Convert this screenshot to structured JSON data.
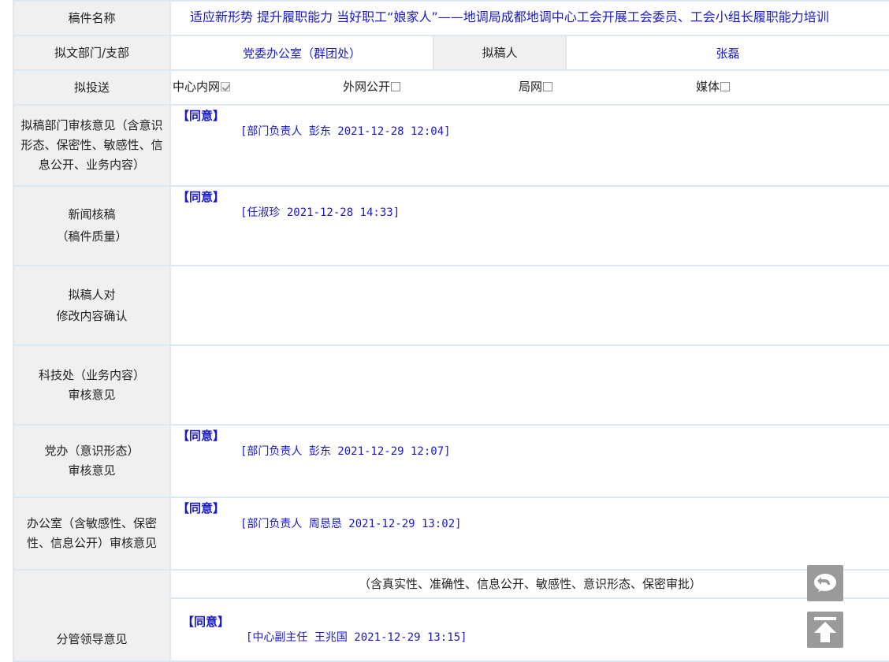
{
  "rows": {
    "title": {
      "label": "稿件名称",
      "value": "适应新形势 提升履职能力 当好职工“娘家人”——地调局成都地调中心工会开展工会委员、工会小组长履职能力培训"
    },
    "dept": {
      "label": "拟文部门/支部",
      "value": "党委办公室（群团处）",
      "author_label": "拟稿人",
      "author": "张磊"
    },
    "send": {
      "label": "拟投送",
      "options": [
        {
          "label": "中心内网",
          "checked": true
        },
        {
          "label": "外网公开",
          "checked": false
        },
        {
          "label": "局网",
          "checked": false
        },
        {
          "label": "媒体",
          "checked": false
        }
      ]
    },
    "dept_review": {
      "label": "拟稿部门审核意见（含意识形态、保密性、敏感性、信息公开、业务内容）",
      "agree": "【同意】",
      "sign": "[部门负责人 彭东 2021-12-28 12:04]"
    },
    "news_review": {
      "label": "新闻核稿",
      "label2": "（稿件质量）",
      "agree": "【同意】",
      "sign": "[任淑珍 2021-12-28 14:33]"
    },
    "author_confirm": {
      "label": "拟稿人对",
      "label2": "修改内容确认"
    },
    "tech_review": {
      "label": "科技处（业务内容）",
      "label2": "审核意见"
    },
    "party_review": {
      "label": "党办（意识形态）",
      "label2": "审核意见",
      "agree": "【同意】",
      "sign": "[部门负责人 彭东 2021-12-29 12:07]"
    },
    "office_review": {
      "label": "办公室（含敏感性、保密性、信息公开）审核意见",
      "agree": "【同意】",
      "sign": "[部门负责人 周恳恳 2021-12-29 13:02]"
    },
    "leader_review": {
      "label": "分管领导意见",
      "note": "（含真实性、准确性、信息公开、敏感性、意识形态、保密审批）",
      "agree": "【同意】",
      "sign": "[中心副主任 王兆国 2021-12-29 13:15]"
    }
  },
  "floating": {
    "back_icon": "chat-back-icon",
    "top_icon": "back-to-top-icon"
  },
  "colors": {
    "label_bg": "#f0f0f0",
    "border": "#dfe7ef",
    "blue_text": "#1919c8",
    "float_btn": "#9a9a9a"
  }
}
